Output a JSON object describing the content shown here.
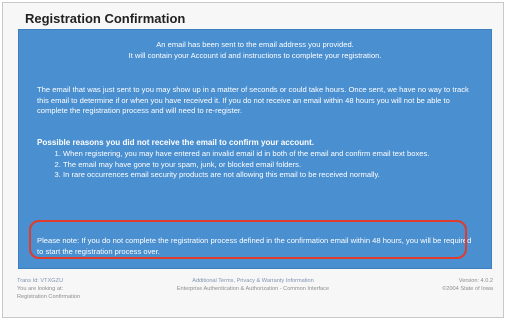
{
  "page": {
    "title": "Registration Confirmation"
  },
  "message": {
    "intro_line1": "An email has been sent to the email address you provided.",
    "intro_line2": "It will contain your Account id and instructions to complete your registration.",
    "body": "The email that was just sent to you may show up in a matter of seconds or could take hours. Once sent, we have no way to track this email to determine if or when you have received it. If you do not receive an email within 48 hours you will not be able to complete the registration process and will need to re-register.",
    "reasons_title": "Possible reasons you did not receive the email to confirm your account.",
    "reasons": [
      "When registering, you may have entered an invalid email id in both of the email and confirm email text boxes.",
      "The email may have gone to your spam, junk, or blocked email folders.",
      "In rare occurrences email security products are not allowing this email to be received normally."
    ],
    "note": "Please note: If you do not complete the registration process defined in the confirmation email within 48 hours, you will be required to start the registration process over."
  },
  "footer": {
    "trans_id": "Trans Id: VTXGZU",
    "looking_at": "You are looking at:",
    "page_name": "Registration Confirmation",
    "links": "Additional Terms, Privacy & Warranty Information",
    "subtitle": "Enterprise Authentication & Authorization - Common Interface",
    "version": "Version: 4.0.2",
    "copyright": "©2004 State of Iowa"
  },
  "colors": {
    "panel": "#4a8fd0",
    "highlight_border": "#e03b2d"
  }
}
